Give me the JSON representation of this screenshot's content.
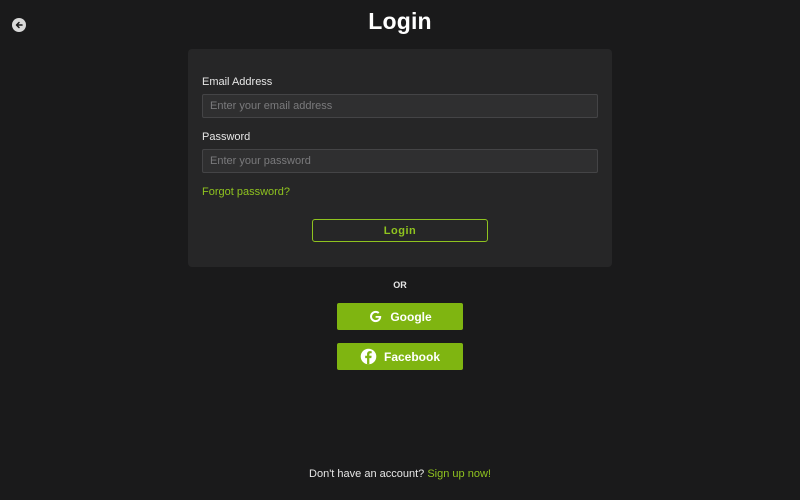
{
  "header": {
    "title": "Login",
    "back_icon": "arrow-left-circle-icon"
  },
  "form": {
    "email": {
      "label": "Email Address",
      "placeholder": "Enter your email address",
      "value": ""
    },
    "password": {
      "label": "Password",
      "placeholder": "Enter your password",
      "value": ""
    },
    "forgot_label": "Forgot password?",
    "login_label": "Login"
  },
  "divider": {
    "label": "OR"
  },
  "social": {
    "google": {
      "label": "Google",
      "icon": "google-icon"
    },
    "facebook": {
      "label": "Facebook",
      "icon": "facebook-icon"
    }
  },
  "footer": {
    "prompt": "Don't have an account?",
    "signup_label": "Sign up now!"
  },
  "colors": {
    "background": "#1a1a1b",
    "card": "#262627",
    "accent": "#8fc31f",
    "social_button": "#7fb511"
  }
}
